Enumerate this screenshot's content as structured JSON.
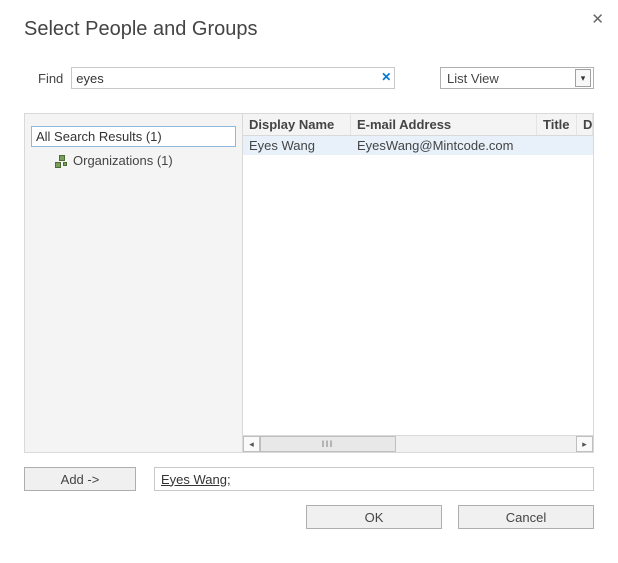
{
  "title": "Select People and Groups",
  "close_glyph": "✕",
  "find": {
    "label": "Find",
    "value": "eyes",
    "clear_glyph": "✕"
  },
  "view": {
    "selected": "List View",
    "chevron": "▾"
  },
  "tree": {
    "root_label": "All Search Results (1)",
    "child_label": "Organizations (1)"
  },
  "columns": {
    "name": "Display Name",
    "email": "E-mail Address",
    "title": "Title",
    "last": "D"
  },
  "results": [
    {
      "name": "Eyes Wang",
      "email": "EyesWang@Mintcode.com",
      "title": ""
    }
  ],
  "hscroll": {
    "left": "◂",
    "right": "▸",
    "grip": "lll"
  },
  "add_button": "Add ->",
  "selected_text": "Eyes Wang;",
  "buttons": {
    "ok": "OK",
    "cancel": "Cancel"
  }
}
